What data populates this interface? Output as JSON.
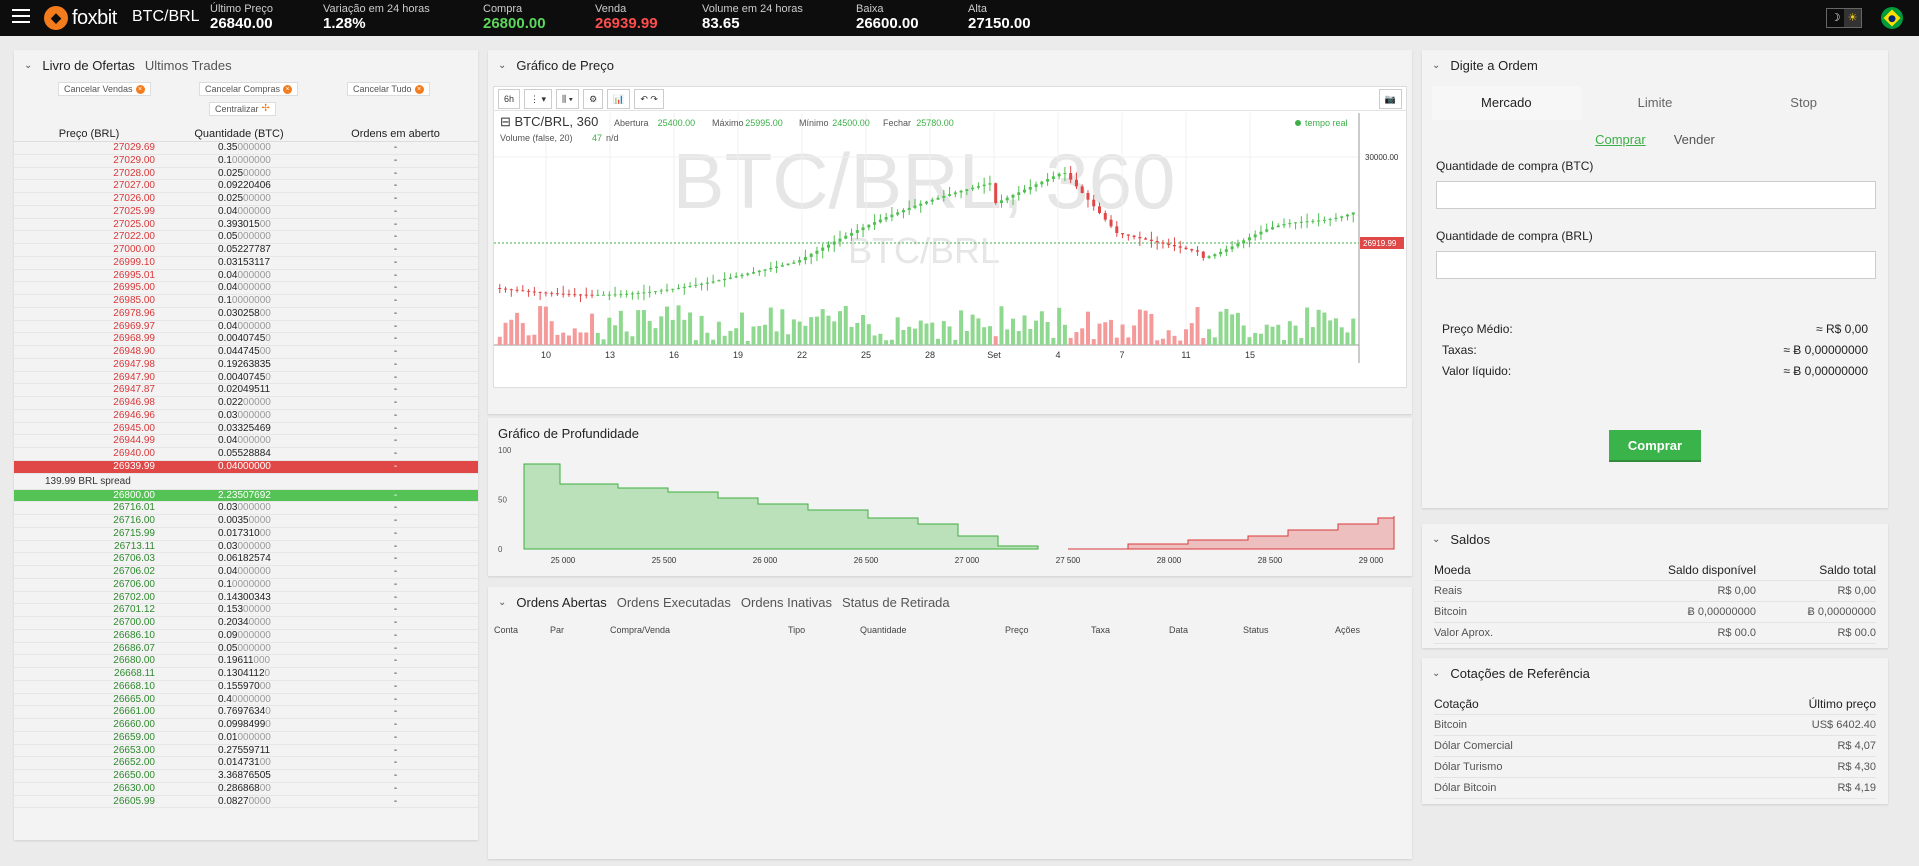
{
  "topbar": {
    "logo": "foxbit",
    "pair": "BTC/BRL",
    "stats": [
      {
        "label": "Último Preço",
        "value": "26840.00",
        "color": "white",
        "left": 210
      },
      {
        "label": "Variação em 24 horas",
        "value": "1.28%",
        "color": "white",
        "left": 323
      },
      {
        "label": "Compra",
        "value": "26800.00",
        "color": "green",
        "left": 483
      },
      {
        "label": "Venda",
        "value": "26939.99",
        "color": "red",
        "left": 595
      },
      {
        "label": "Volume em 24 horas",
        "value": "83.65",
        "color": "white",
        "left": 702
      },
      {
        "label": "Baixa",
        "value": "26600.00",
        "color": "white",
        "left": 856
      },
      {
        "label": "Alta",
        "value": "27150.00",
        "color": "white",
        "left": 968
      }
    ]
  },
  "orderbook": {
    "tab_active": "Livro de Ofertas",
    "tab_inactive": "Ultimos Trades",
    "btn_cancel_sells": "Cancelar Vendas",
    "btn_cancel_buys": "Cancelar Compras",
    "btn_cancel_all": "Cancelar Tudo",
    "btn_center": "Centralizar",
    "col_price": "Preço (BRL)",
    "col_qty": "Quantidade (BTC)",
    "col_open": "Ordens em aberto",
    "asks": [
      [
        "27029.69",
        "0.35",
        "000000"
      ],
      [
        "27029.00",
        "0.1",
        "0000000"
      ],
      [
        "27028.00",
        "0.025",
        "00000"
      ],
      [
        "27027.00",
        "0.09220406",
        ""
      ],
      [
        "27026.00",
        "0.025",
        "00000"
      ],
      [
        "27025.99",
        "0.04",
        "000000"
      ],
      [
        "27025.00",
        "0.393015",
        "00"
      ],
      [
        "27022.00",
        "0.05",
        "000000"
      ],
      [
        "27000.00",
        "0.05227787",
        ""
      ],
      [
        "26999.10",
        "0.03153117",
        ""
      ],
      [
        "26995.01",
        "0.04",
        "000000"
      ],
      [
        "26995.00",
        "0.04",
        "000000"
      ],
      [
        "26985.00",
        "0.1",
        "0000000"
      ],
      [
        "26978.96",
        "0.030258",
        "00"
      ],
      [
        "26969.97",
        "0.04",
        "000000"
      ],
      [
        "26968.99",
        "0.0040745",
        "0"
      ],
      [
        "26948.90",
        "0.044745",
        "00"
      ],
      [
        "26947.98",
        "0.19263835",
        ""
      ],
      [
        "26947.90",
        "0.0040745",
        "0"
      ],
      [
        "26947.87",
        "0.02049511",
        ""
      ],
      [
        "26946.98",
        "0.022",
        "00000"
      ],
      [
        "26946.96",
        "0.03",
        "000000"
      ],
      [
        "26945.00",
        "0.03325469",
        ""
      ],
      [
        "26944.99",
        "0.04",
        "000000"
      ],
      [
        "26940.00",
        "0.05528884",
        ""
      ],
      [
        "26939.99",
        "0.04",
        "000000"
      ]
    ],
    "spread": "139.99 BRL spread",
    "bids": [
      [
        "26800.00",
        "2.23507692",
        ""
      ],
      [
        "26716.01",
        "0.03",
        "000000"
      ],
      [
        "26716.00",
        "0.0035",
        "0000"
      ],
      [
        "26715.99",
        "0.017310",
        "00"
      ],
      [
        "26713.11",
        "0.03",
        "000000"
      ],
      [
        "26706.03",
        "0.06182574",
        ""
      ],
      [
        "26706.02",
        "0.04",
        "000000"
      ],
      [
        "26706.00",
        "0.1",
        "0000000"
      ],
      [
        "26702.00",
        "0.14300343",
        ""
      ],
      [
        "26701.12",
        "0.153",
        "00000"
      ],
      [
        "26700.00",
        "0.2034",
        "0000"
      ],
      [
        "26686.10",
        "0.09",
        "000000"
      ],
      [
        "26686.07",
        "0.05",
        "000000"
      ],
      [
        "26680.00",
        "0.19611",
        "000"
      ],
      [
        "26668.11",
        "0.1304112",
        "0"
      ],
      [
        "26668.10",
        "0.155970",
        "00"
      ],
      [
        "26665.00",
        "0.4",
        "0000000"
      ],
      [
        "26661.00",
        "0.7697634",
        "0"
      ],
      [
        "26660.00",
        "0.0998499",
        "0"
      ],
      [
        "26659.00",
        "0.01",
        "000000"
      ],
      [
        "26653.00",
        "0.27559711",
        ""
      ],
      [
        "26652.00",
        "0.014731",
        "00"
      ],
      [
        "26650.00",
        "3.36876505",
        ""
      ],
      [
        "26630.00",
        "0.286868",
        "00"
      ],
      [
        "26605.99",
        "0.0827",
        "0000"
      ]
    ],
    "open_dash": "-"
  },
  "price_chart": {
    "title": "Gráfico de Preço",
    "interval": "6h",
    "legend_symbol": "BTC/BRL, 360",
    "open_label": "Abertura",
    "open": "25400.00",
    "high_label": "Máximo",
    "high": "25995.00",
    "low_label": "Mínimo",
    "low": "24500.00",
    "close_label": "Fechar",
    "close": "25780.00",
    "volume_label": "Volume (false, 20)",
    "volume_val": "47",
    "volume_na": "n/d",
    "realtime": "tempo real",
    "watermark_big": "BTC/BRL, 360",
    "watermark_small": "BTC/BRL",
    "y_tick": "30000.00",
    "last_price": "26919.99",
    "x_ticks": [
      "10",
      "13",
      "16",
      "19",
      "22",
      "25",
      "28",
      "Set",
      "4",
      "7",
      "11",
      "15"
    ]
  },
  "depth_chart": {
    "title": "Gráfico de Profundidade",
    "y_ticks": [
      "100",
      "50",
      "0"
    ],
    "x_ticks": [
      "25 000",
      "25 500",
      "26 000",
      "26 500",
      "27 000",
      "27 500",
      "28 000",
      "28 500",
      "29 000"
    ],
    "colors": {
      "bid": "#4fbf4f",
      "ask": "#e04848"
    }
  },
  "open_orders": {
    "tabs": [
      "Ordens Abertas",
      "Ordens Executadas",
      "Ordens Inativas",
      "Status de Retirada"
    ],
    "columns": [
      "Conta",
      "Par",
      "Compra/Venda",
      "Tipo",
      "Quantidade",
      "Preço",
      "Taxa",
      "Data",
      "Status",
      "Ações"
    ]
  },
  "order_form": {
    "title": "Digite a Ordem",
    "tabs": [
      "Mercado",
      "Limite",
      "Stop"
    ],
    "buy": "Comprar",
    "sell": "Vender",
    "qty_btc_label": "Quantidade de compra (BTC)",
    "qty_brl_label": "Quantidade de compra (BRL)",
    "avg_price_label": "Preço Médio:",
    "avg_price": "≈ R$ 0,00",
    "fees_label": "Taxas:",
    "fees": "≈ Ƀ 0,00000000",
    "net_label": "Valor líquido:",
    "net": "≈ Ƀ 0,00000000",
    "submit": "Comprar"
  },
  "balances": {
    "title": "Saldos",
    "col_currency": "Moeda",
    "col_available": "Saldo disponível",
    "col_total": "Saldo total",
    "rows": [
      [
        "Reais",
        "R$ 0,00",
        "R$ 0,00"
      ],
      [
        "Bitcoin",
        "Ƀ 0,00000000",
        "Ƀ 0,00000000"
      ],
      [
        "Valor Aprox.",
        "R$ 00.0",
        "R$ 00.0"
      ]
    ]
  },
  "quotes": {
    "title": "Cotações de Referência",
    "col_quote": "Cotação",
    "col_last": "Último preço",
    "rows": [
      [
        "Bitcoin",
        "US$ 6402.40"
      ],
      [
        "Dólar Comercial",
        "R$ 4,07"
      ],
      [
        "Dólar Turismo",
        "R$ 4,30"
      ],
      [
        "Dólar Bitcoin",
        "R$ 4,19"
      ]
    ]
  }
}
